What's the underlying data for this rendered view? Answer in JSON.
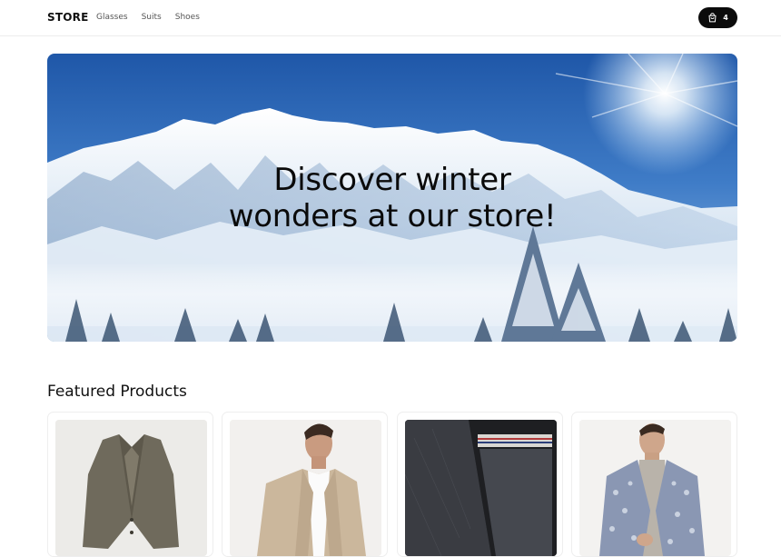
{
  "nav": {
    "brand": "STORE",
    "links": [
      "Glasses",
      "Suits",
      "Shoes"
    ],
    "cart_count": "4",
    "cart_icon": "shopping-bag-icon"
  },
  "hero": {
    "line1": "Discover winter",
    "line2": "wonders at our store!"
  },
  "featured": {
    "title": "Featured Products",
    "products": [
      {
        "image": "olive-blazer"
      },
      {
        "image": "beige-suit-jacket-model"
      },
      {
        "image": "dark-denim-jacket-closeup"
      },
      {
        "image": "patterned-blazer-model"
      }
    ]
  },
  "colors": {
    "accent": "#0b0b0b",
    "sky": "#2f67b4"
  }
}
